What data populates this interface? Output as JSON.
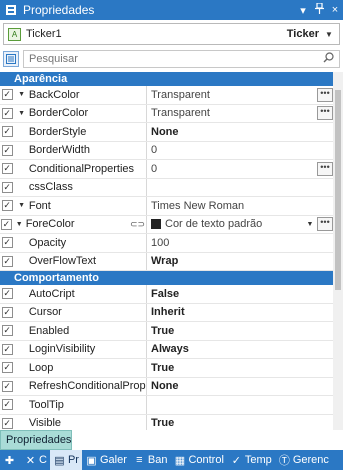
{
  "titlebar": {
    "title": "Propriedades",
    "dropdown_glyph": "▾",
    "pin_glyph": "ᵽ",
    "close_glyph": "×"
  },
  "selector": {
    "object_name": "Ticker1",
    "object_type": "Ticker",
    "object_icon_text": "A"
  },
  "search": {
    "placeholder": "Pesquisar"
  },
  "sections": [
    {
      "title": "Aparência",
      "rows": [
        {
          "name": "BackColor",
          "value": "Transparent",
          "expander": true,
          "dots": true,
          "bold": false
        },
        {
          "name": "BorderColor",
          "value": "Transparent",
          "expander": true,
          "dots": true,
          "bold": false
        },
        {
          "name": "BorderStyle",
          "value": "None",
          "dropdown": true,
          "bold": true
        },
        {
          "name": "BorderWidth",
          "value": "0",
          "bold": false
        },
        {
          "name": "ConditionalProperties",
          "value": "0",
          "dots": true,
          "bold": false
        },
        {
          "name": "cssClass",
          "value": "",
          "bold": false
        },
        {
          "name": "Font",
          "value": "Times New Roman",
          "expander": true,
          "bold": false
        },
        {
          "name": "ForeColor",
          "value": "Cor de texto padrão",
          "expander": true,
          "dropdown": true,
          "dots": true,
          "swatch": "#222222",
          "link": true,
          "bold": false
        },
        {
          "name": "Opacity",
          "value": "100",
          "bold": false
        },
        {
          "name": "OverFlowText",
          "value": "Wrap",
          "dropdown": true,
          "bold": true
        }
      ]
    },
    {
      "title": "Comportamento",
      "rows": [
        {
          "name": "AutoCript",
          "value": "False",
          "dropdown": true,
          "bold": true
        },
        {
          "name": "Cursor",
          "value": "Inherit",
          "dropdown": true,
          "bold": true
        },
        {
          "name": "Enabled",
          "value": "True",
          "dropdown": true,
          "bold": true
        },
        {
          "name": "LoginVisibility",
          "value": "Always",
          "dropdown": true,
          "bold": true
        },
        {
          "name": "Loop",
          "value": "True",
          "dropdown": true,
          "bold": true
        },
        {
          "name": "RefreshConditionalProperties",
          "value": "None",
          "dropdown": true,
          "bold": true
        },
        {
          "name": "ToolTip",
          "value": "",
          "bold": false
        },
        {
          "name": "Visible",
          "value": "True",
          "dropdown": true,
          "bold": true
        }
      ]
    }
  ],
  "tab": {
    "label": "Propriedades"
  },
  "bottombar": {
    "items": [
      {
        "icon": "✚",
        "label": ""
      },
      {
        "icon": "✕",
        "label": "C"
      },
      {
        "icon": "▤",
        "label": "Pr",
        "active": true
      },
      {
        "icon": "▣",
        "label": "Galer"
      },
      {
        "icon": "≡",
        "label": "Ban"
      },
      {
        "icon": "▦",
        "label": "Control"
      },
      {
        "icon": "✓",
        "label": "Temp"
      },
      {
        "icon": "Ⓣ",
        "label": "Gerenc"
      }
    ]
  },
  "colors": {
    "accent": "#2b78c4",
    "tab_bg": "#a9dcd7"
  }
}
